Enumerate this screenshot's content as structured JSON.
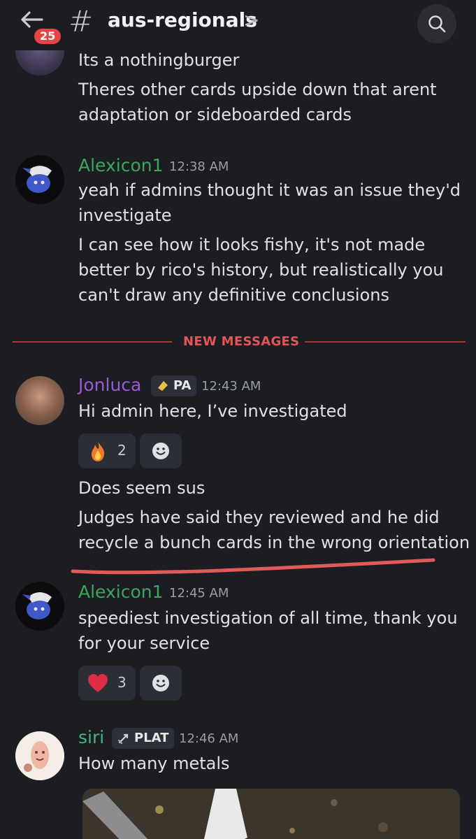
{
  "header": {
    "badge_count": "25",
    "hash": "#",
    "channel": "aus-regionals",
    "chevron": ">"
  },
  "messages": {
    "prev": {
      "lines": [
        "Its a nothingburger",
        "Theres other cards upside down that arent",
        "adaptation or sideboarded cards"
      ]
    },
    "alexicon1_a": {
      "name": "Alexicon1",
      "time": "12:38 AM",
      "lines": [
        "yeah if admins thought it was an issue they'd",
        "investigate",
        "I can see how it looks fishy, it's not made",
        "better by rico's history, but realistically you",
        "can't draw any definitive conclusions"
      ]
    },
    "divider": {
      "label": "NEW MESSAGES"
    },
    "jonluca": {
      "name": "Jonluca",
      "tag": "PA",
      "time": "12:43 AM",
      "lines": [
        "Hi admin here, I’ve investigated",
        "Does seem sus",
        "Judges have said they reviewed and he did",
        "recycle a bunch cards in the wrong orientation"
      ],
      "reaction": {
        "emoji": "fire-emoji",
        "count": "2"
      }
    },
    "alexicon1_b": {
      "name": "Alexicon1",
      "time": "12:45 AM",
      "lines": [
        "speediest investigation of all time, thank you",
        "for your service"
      ],
      "reaction": {
        "emoji": "heart-emoji",
        "count": "3"
      }
    },
    "siri": {
      "name": "siri",
      "tag": "PLAT",
      "time": "12:46 AM",
      "lines": [
        "How many metals"
      ]
    }
  },
  "colors": {
    "background": "#1c1d22",
    "alexicon_name": "#3ba55c",
    "jonluca_name": "#9b59d6",
    "siri_name": "#43b581",
    "new_messages": "#e25555",
    "badge": "#e64545",
    "annotation_underline": "#e05a5a"
  }
}
